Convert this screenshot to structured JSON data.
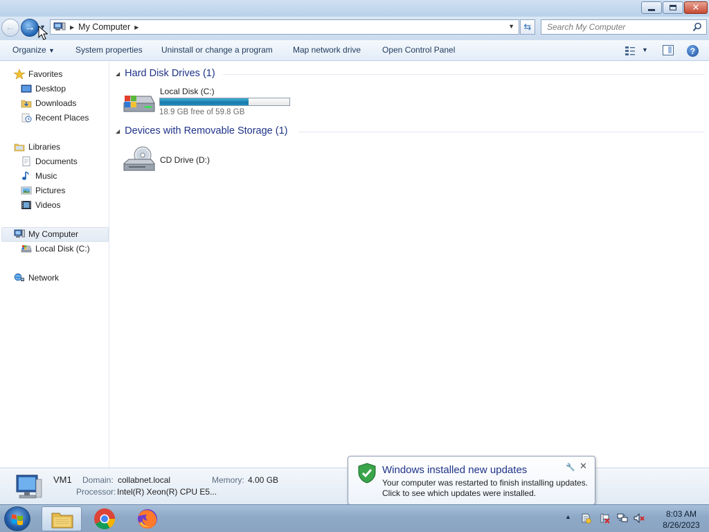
{
  "window": {
    "controls": {
      "minimize": "minimize",
      "maximize": "restore",
      "close": "close"
    }
  },
  "address_bar": {
    "path": [
      "My Computer"
    ],
    "current": "My Computer"
  },
  "search": {
    "placeholder": "Search My Computer"
  },
  "toolbar": {
    "organize": "Organize",
    "system_properties": "System properties",
    "uninstall": "Uninstall or change a program",
    "map_drive": "Map network drive",
    "control_panel": "Open Control Panel"
  },
  "nav_pane": {
    "favorites": {
      "label": "Favorites",
      "items": [
        "Desktop",
        "Downloads",
        "Recent Places"
      ]
    },
    "libraries": {
      "label": "Libraries",
      "items": [
        "Documents",
        "Music",
        "Pictures",
        "Videos"
      ]
    },
    "computer": {
      "label": "My Computer",
      "items": [
        "Local Disk (C:)"
      ]
    },
    "network": {
      "label": "Network"
    }
  },
  "content": {
    "hard_disks": {
      "header": "Hard Disk Drives (1)",
      "drives": [
        {
          "label": "Local Disk (C:)",
          "free_text": "18.9 GB free of 59.8 GB",
          "free_gb": 18.9,
          "total_gb": 59.8
        }
      ]
    },
    "removable": {
      "header": "Devices with Removable Storage (1)",
      "drives": [
        {
          "label": "CD Drive (D:)"
        }
      ]
    }
  },
  "details": {
    "computer_name": "VM1",
    "domain_label": "Domain:",
    "domain_value": "collabnet.local",
    "memory_label": "Memory:",
    "memory_value": "4.00 GB",
    "processor_label": "Processor:",
    "processor_value": "Intel(R) Xeon(R) CPU E5..."
  },
  "notification": {
    "title": "Windows installed new updates",
    "line1": "Your computer was restarted to finish installing updates.",
    "line2": "Click to see which updates were installed."
  },
  "taskbar": {
    "apps": [
      "windows-explorer",
      "google-chrome",
      "firefox"
    ],
    "clock_time": "8:03 AM",
    "clock_date": "8/26/2023"
  },
  "colors": {
    "group_header": "#1e3287",
    "capacity_fill": "#1f8dbf",
    "taskbar": "#8ea9c7"
  }
}
